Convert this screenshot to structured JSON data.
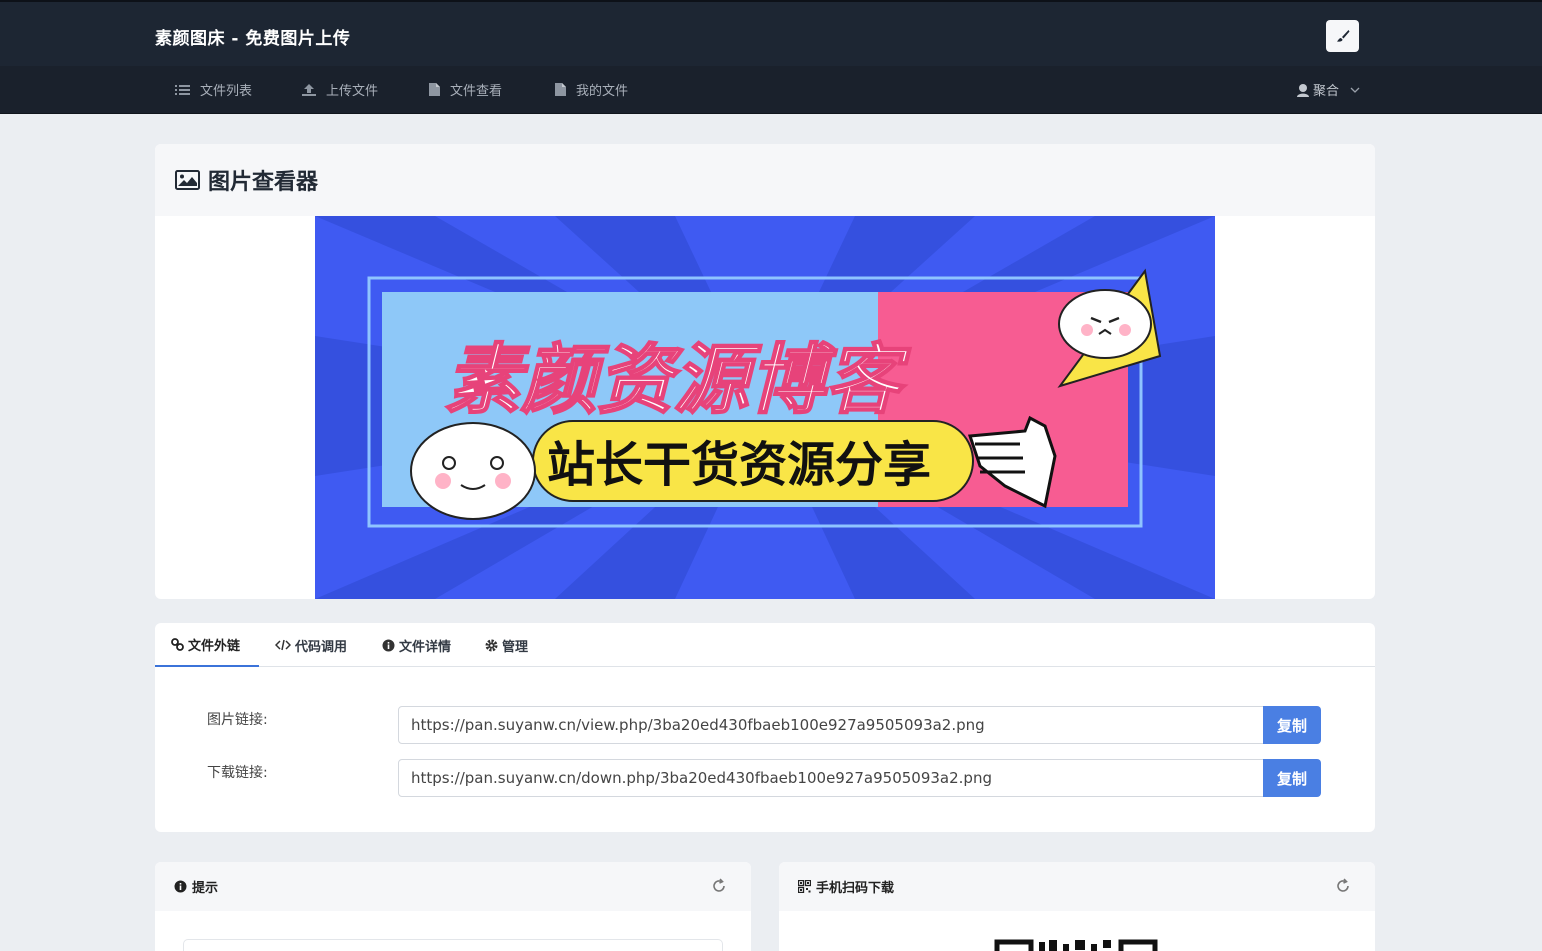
{
  "header": {
    "brand": "素颜图床 - 免费图片上传",
    "theme_button_icon": "brush-icon"
  },
  "nav": {
    "items": [
      {
        "label": "文件列表",
        "icon": "list-icon"
      },
      {
        "label": "上传文件",
        "icon": "upload-icon"
      },
      {
        "label": "文件查看",
        "icon": "file-icon"
      },
      {
        "label": "我的文件",
        "icon": "file-icon"
      }
    ],
    "user": {
      "label": "聚合",
      "icon": "user-icon"
    }
  },
  "viewer": {
    "title": "图片查看器",
    "title_icon": "image-icon",
    "banner": {
      "headline": "素颜资源博客",
      "subline": "站长干货资源分享"
    }
  },
  "links": {
    "tabs": [
      {
        "label": "文件外链",
        "icon": "link-icon",
        "active": true
      },
      {
        "label": "代码调用",
        "icon": "code-icon",
        "active": false
      },
      {
        "label": "文件详情",
        "icon": "info-icon",
        "active": false
      },
      {
        "label": "管理",
        "icon": "gear-icon",
        "active": false
      }
    ],
    "image_link": {
      "label": "图片链接:",
      "value": "https://pan.suyanw.cn/view.php/3ba20ed430fbaeb100e927a9505093a2.png",
      "button": "复制"
    },
    "download_link": {
      "label": "下载链接:",
      "value": "https://pan.suyanw.cn/down.php/3ba20ed430fbaeb100e927a9505093a2.png",
      "button": "复制"
    }
  },
  "tip_card": {
    "title": "提示",
    "icon": "info-icon"
  },
  "qr_card": {
    "title": "手机扫码下载",
    "icon": "qrcode-icon"
  },
  "colors": {
    "header_bg": "#1d2633",
    "page_bg": "#ebeef2",
    "accent": "#4a7fe3",
    "banner_blue": "#3f5af2",
    "banner_pink": "#f75c92",
    "banner_yellow": "#f9e547"
  }
}
